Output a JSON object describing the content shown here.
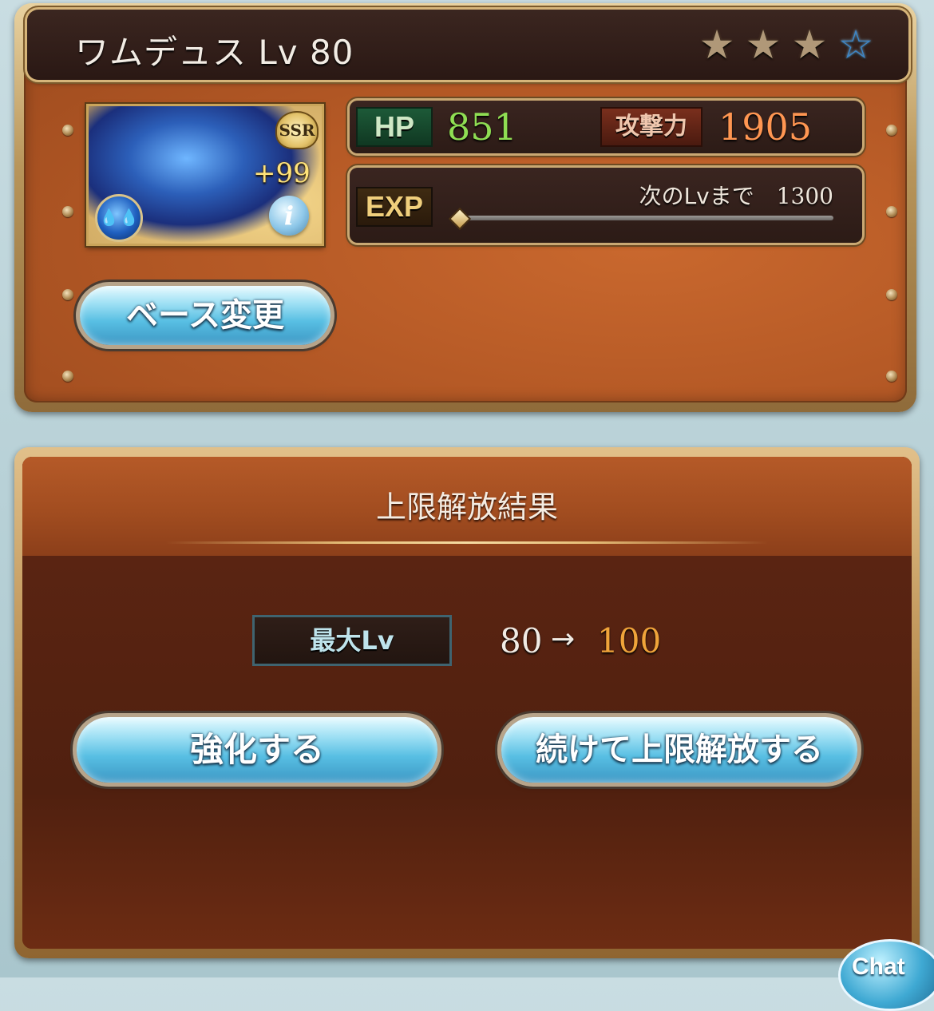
{
  "header": {
    "title": "ワムデュス Lv 80",
    "stars": [
      {
        "icon": "star-filled-icon",
        "glyph": "★",
        "state": "filled"
      },
      {
        "icon": "star-filled-icon",
        "glyph": "★",
        "state": "filled"
      },
      {
        "icon": "star-filled-icon",
        "glyph": "★",
        "state": "filled"
      },
      {
        "icon": "star-empty-icon",
        "glyph": "☆",
        "state": "empty"
      }
    ]
  },
  "card": {
    "rarity": "SSR",
    "plus": "+99",
    "element_icon": "water-element-icon",
    "element_glyph": "💧💧",
    "info_glyph": "i"
  },
  "stats": {
    "hp_label": "HP",
    "hp_value": "851",
    "atk_label": "攻撃力",
    "atk_value": "1905",
    "exp_label": "EXP",
    "next_level_label": "次のLvまで",
    "next_level_value": "1300",
    "exp_progress": 0
  },
  "buttons": {
    "base_change": "ベース変更",
    "enhance": "強化する",
    "continue_uncap": "続けて上限解放する"
  },
  "result": {
    "title": "上限解放結果",
    "max_lv_label": "最大Lv",
    "lv_from": "80",
    "arrow": "→",
    "lv_to": "100"
  },
  "chat": {
    "label": "Chat"
  },
  "colors": {
    "hp": "#8fde53",
    "atk": "#ff9652",
    "lv_new": "#f0a43a",
    "star_empty": "#3c86c9"
  }
}
